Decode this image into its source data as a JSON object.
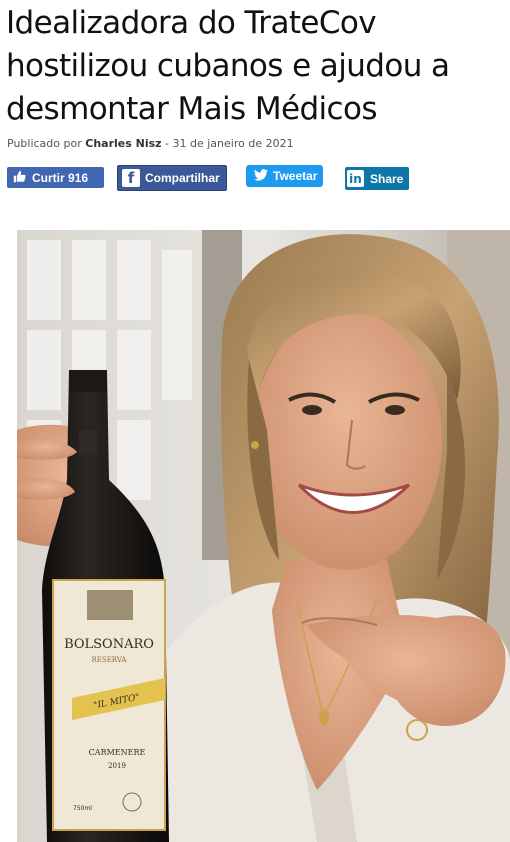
{
  "article": {
    "title_lines": [
      "Idealizadora do TrateCov",
      "hostilizou cubanos e ajudou a",
      "desmontar Mais Médicos"
    ],
    "byline_prefix": "Publicado por",
    "author": "Charles Nisz",
    "separator": " - ",
    "date": "31 de janeiro de 2021"
  },
  "share": {
    "like_label": "Curtir 916",
    "facebook_label": "Compartilhar",
    "twitter_label": "Tweetar",
    "linkedin_label": "Share"
  },
  "photo": {
    "label_brand": "BOLSONARO",
    "label_reserva": "RESERVA",
    "label_banner": "\"IL MITO\"",
    "label_variety": "CARMENERE",
    "label_year": "2019",
    "label_volume": "750ml"
  },
  "icons": {
    "like": "thumbs-up-icon",
    "facebook": "facebook-icon",
    "twitter": "twitter-bird-icon",
    "linkedin": "linkedin-icon"
  },
  "colors": {
    "facebook": "#3b5998",
    "like": "#4267b2",
    "twitter": "#1d9bf0",
    "linkedin": "#0e76a8"
  }
}
